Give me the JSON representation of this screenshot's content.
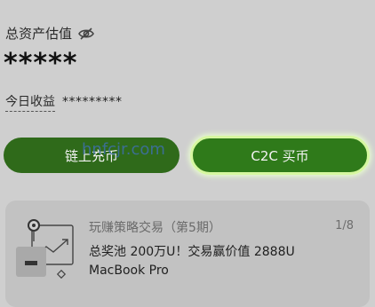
{
  "assets": {
    "label": "总资产估值",
    "hidden_value": "*****",
    "visibility_icon": "eye-off-icon"
  },
  "earnings": {
    "label": "今日收益",
    "value": "*********"
  },
  "actions": {
    "onchain_label": "链上充币",
    "c2c_label": "C2C 买币"
  },
  "watermark": "hnfcjr.com",
  "promo": {
    "title": "玩赚策略交易（第5期）",
    "page": "1/8",
    "line1": "总奖池 200万U！交易赢价值 2888U",
    "line2": "MacBook Pro"
  },
  "colors": {
    "primary_button": "#2f6a1a",
    "highlight_border": "#d6f7a0",
    "background": "#cfcfcf"
  }
}
